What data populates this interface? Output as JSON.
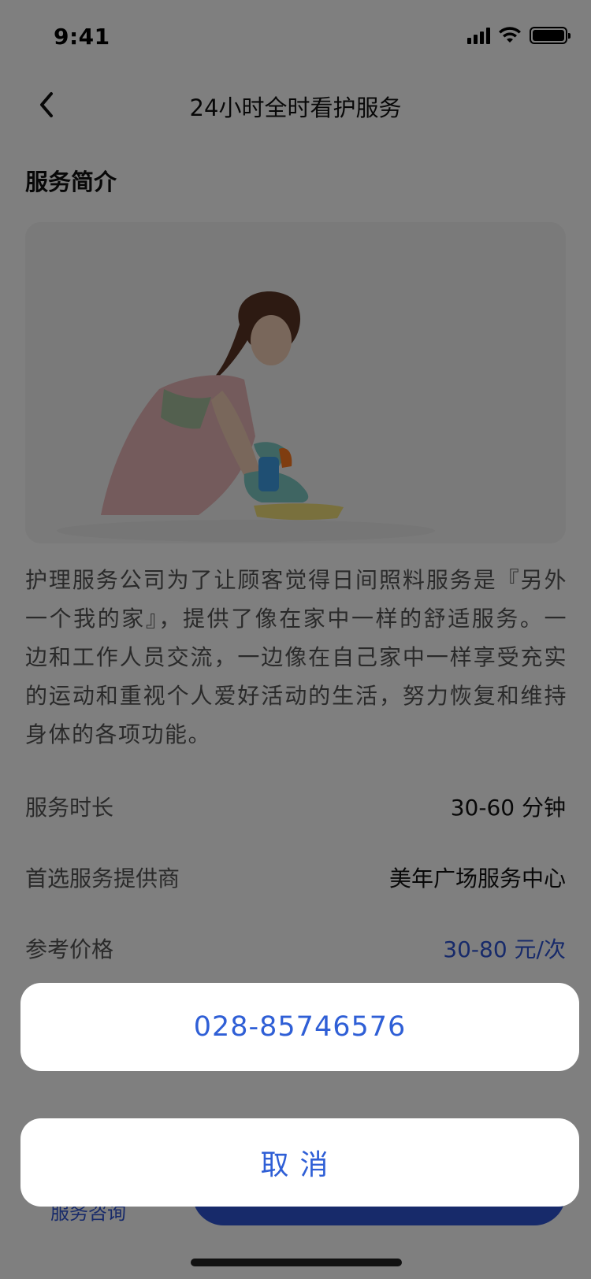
{
  "status_bar": {
    "time": "9:41"
  },
  "nav": {
    "title": "24小时全时看护服务"
  },
  "intro": {
    "section_title": "服务简介",
    "description": "护理服务公司为了让顾客觉得日间照料服务是『另外一个我的家』，提供了像在家中一样的舒适服务。一边和工作人员交流，一边像在自己家中一样享受充实的运动和重视个人爱好活动的生活，努力恢复和维持身体的各项功能。"
  },
  "details": [
    {
      "label": "服务时长",
      "value": "30-60 分钟"
    },
    {
      "label": "首选服务提供商",
      "value": "美年广场服务中心"
    },
    {
      "label": "参考价格",
      "value": "30-80 元/次"
    }
  ],
  "bottom_bar": {
    "consult_label": "服务咨询"
  },
  "action_sheet": {
    "phone": "028-85746576",
    "cancel": "取消"
  },
  "colors": {
    "accent": "#2f55d4",
    "overlay": "rgba(0,0,0,0.5)"
  },
  "icons": {
    "back": "chevron-left-icon",
    "signal": "cellular-signal-icon",
    "wifi": "wifi-icon",
    "battery": "battery-icon"
  }
}
